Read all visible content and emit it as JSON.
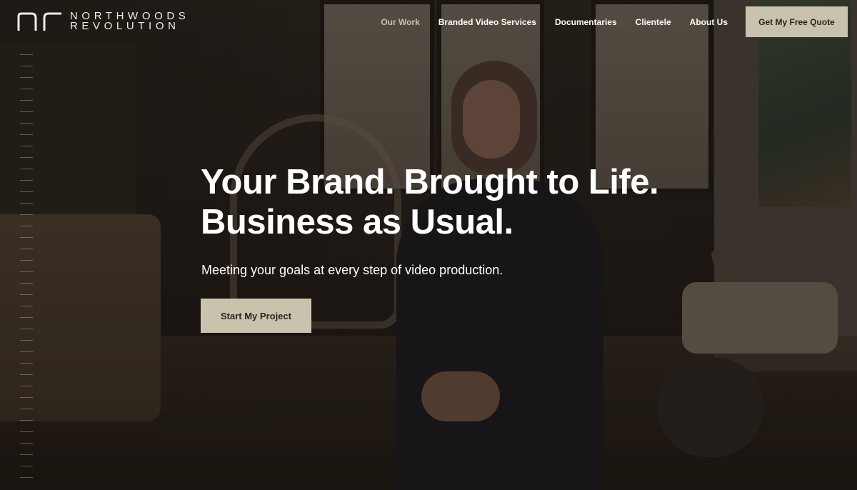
{
  "brand": {
    "logo_icon": "nr-monogram-icon",
    "line1": "NORTHWOODS",
    "line2": "REVOLUTION"
  },
  "nav": {
    "items": [
      {
        "label": "Our Work",
        "active": true
      },
      {
        "label": "Branded Video Services",
        "active": false
      },
      {
        "label": "Documentaries",
        "active": false
      },
      {
        "label": "Clientele",
        "active": false
      },
      {
        "label": "About Us",
        "active": false
      }
    ],
    "cta_label": "Get My Free Quote"
  },
  "hero": {
    "headline_line1": "Your Brand. Brought to Life.",
    "headline_line2": "Business as Usual.",
    "subhead": "Meeting your goals at every step of video production.",
    "cta_label": "Start My Project"
  },
  "colors": {
    "accent": "#c9c2ad",
    "active_nav": "#c9c2ad",
    "text": "#ffffff",
    "button_text": "#2a2520"
  }
}
